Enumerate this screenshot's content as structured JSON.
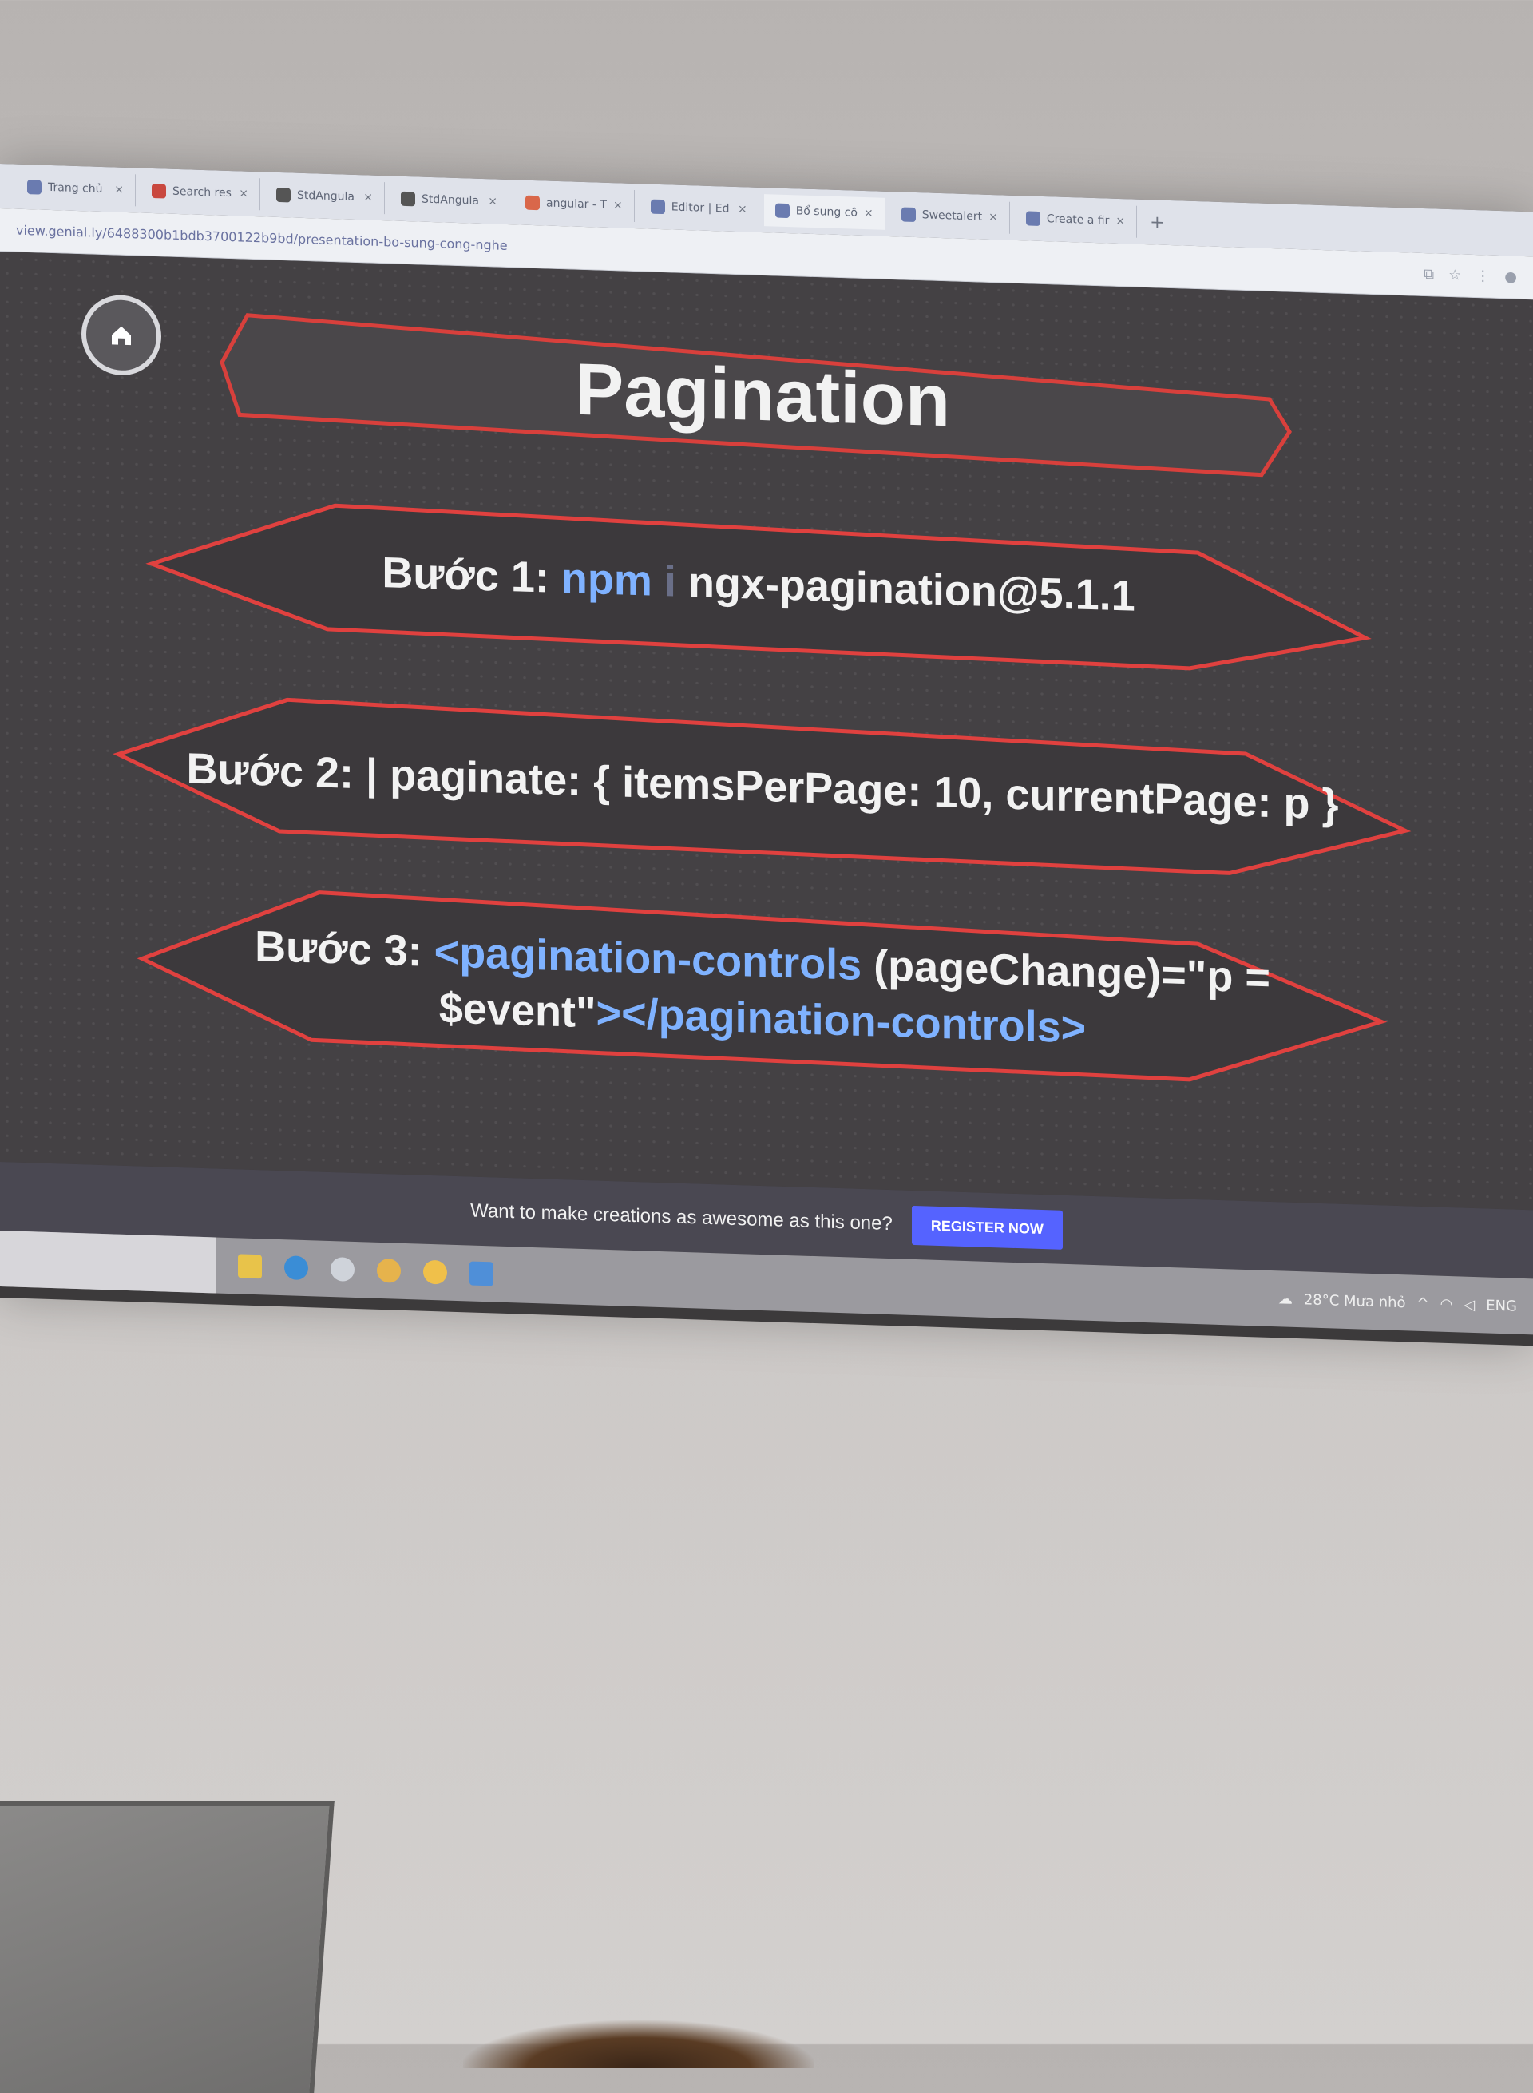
{
  "browser": {
    "tabs": [
      {
        "label": "Trang chủ",
        "close": "×"
      },
      {
        "label": "Search res",
        "close": "×"
      },
      {
        "label": "StdAngula",
        "close": "×"
      },
      {
        "label": "StdAngula",
        "close": "×"
      },
      {
        "label": "angular - T",
        "close": "×"
      },
      {
        "label": "Editor | Ed",
        "close": "×"
      },
      {
        "label": "Bổ sung cô",
        "close": "×"
      },
      {
        "label": "Sweetalert",
        "close": "×"
      },
      {
        "label": "Create a fir",
        "close": "×"
      }
    ],
    "new_tab": "+",
    "url": "view.genial.ly/6488300b1bdb3700122b9bd/presentation-bo-sung-cong-nghe"
  },
  "slide": {
    "title": "Pagination",
    "step1": {
      "label": "Bước 1:",
      "cmd": "npm",
      "sep": "i",
      "pkg": "ngx-pagination@5.1.1"
    },
    "step2": {
      "text": "Bước 2: | paginate: { itemsPerPage: 10, currentPage: p }"
    },
    "step3": {
      "label": "Bước 3:",
      "tag_open": "<pagination-controls",
      "attr": "(pageChange)=\"p =",
      "attr2": "$event\"",
      "tag_close": "></pagination-controls>"
    }
  },
  "register": {
    "text": "Want to make creations as awesome as this one?",
    "button": "REGISTER NOW"
  },
  "taskbar": {
    "weather": "28°C Mưa nhỏ",
    "lang": "ENG"
  },
  "colors": {
    "accent_blue": "#7fb2ff",
    "banner_outline": "#e0413f",
    "register_button": "#5563ff"
  }
}
